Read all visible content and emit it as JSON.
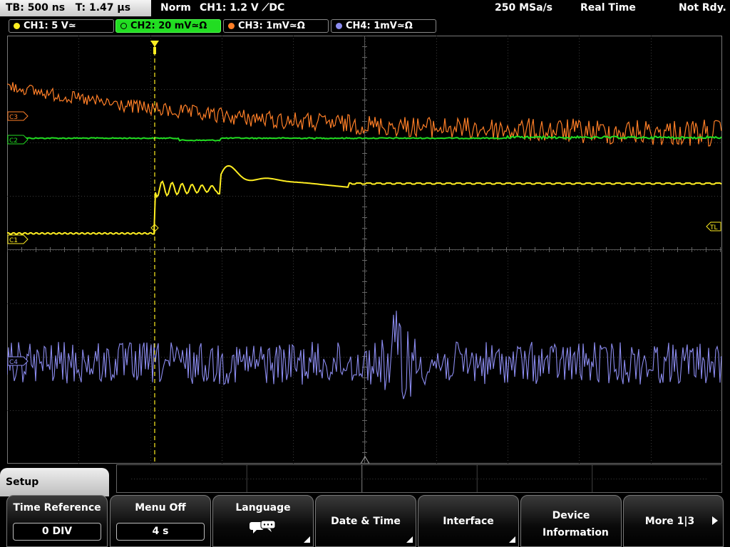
{
  "status": {
    "timebase": "TB: 500 ns   T: 1.47 µs",
    "mode": "Norm",
    "trigger": "CH1: 1.2 V ⟋DC",
    "sample_rate": "250 MSa/s",
    "acquisition": "Real Time",
    "state": "Not Rdy."
  },
  "channels": [
    {
      "label": "CH1: 5 V≃",
      "color": "#ffee22"
    },
    {
      "label": "CH2: 20 mV≃Ω",
      "color": "#22dd22"
    },
    {
      "label": "CH3: 1mV≃Ω",
      "color": "#ff7f27"
    },
    {
      "label": "CH4: 1mV≃Ω",
      "color": "#8c8cf0"
    }
  ],
  "markers": {
    "c3": "C3",
    "c2": "C2",
    "c1": "C1",
    "c4": "C4",
    "tl": "TL"
  },
  "setup_tab": "Setup",
  "softkeys": [
    {
      "label": "Time Reference",
      "value": "0 DIV"
    },
    {
      "label": "Menu Off",
      "value": "4 s"
    },
    {
      "label": "Language",
      "icon": "speech-bubbles-icon"
    },
    {
      "label": "Date & Time"
    },
    {
      "label": "Interface"
    },
    {
      "label": "Device Information"
    },
    {
      "label": "More 1|3"
    }
  ]
}
